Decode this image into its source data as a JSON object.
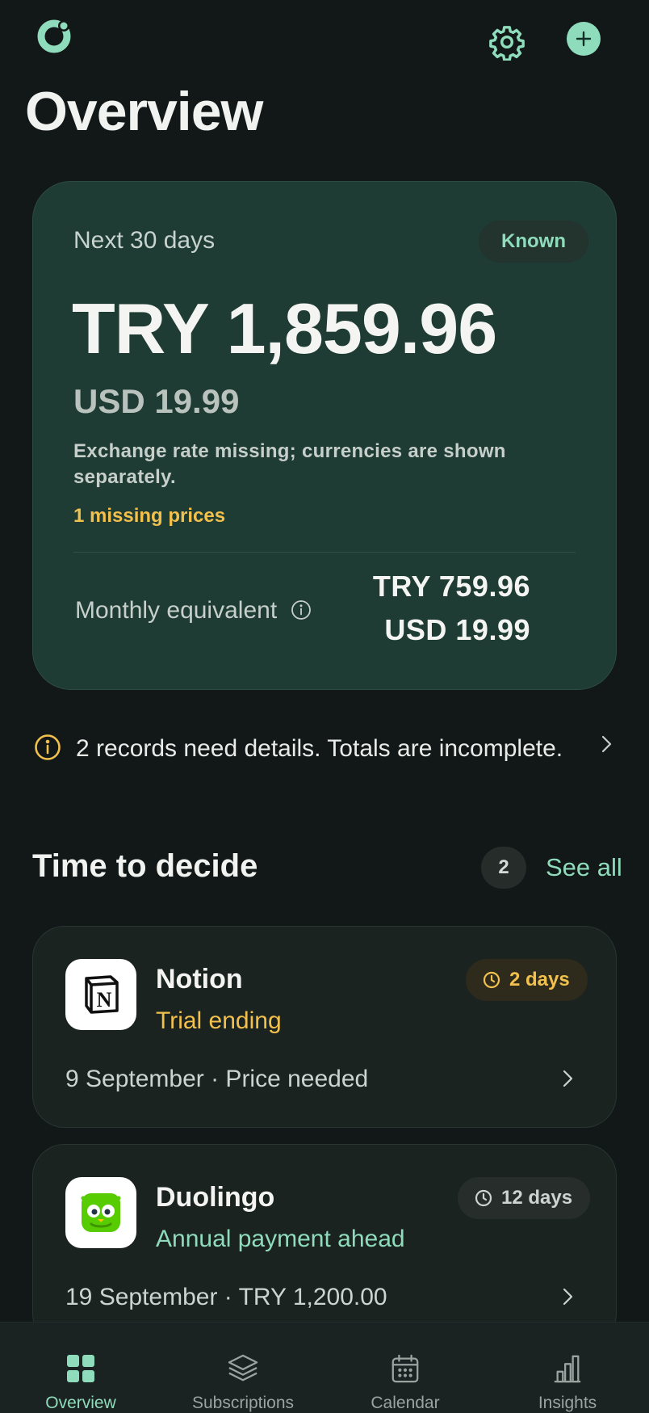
{
  "header": {
    "title": "Overview"
  },
  "summary": {
    "period_label": "Next 30 days",
    "badge": "Known",
    "total_primary": "TRY 1,859.96",
    "total_secondary": "USD 19.99",
    "exchange_note": "Exchange rate missing; currencies are shown separately.",
    "missing_note": "1 missing prices",
    "monthly_label": "Monthly equivalent",
    "monthly_try": "TRY 759.96",
    "monthly_usd": "USD 19.99"
  },
  "notice": {
    "text": "2 records need details. Totals are incomplete."
  },
  "decide": {
    "title": "Time to decide",
    "count": "2",
    "see_all": "See all",
    "items": [
      {
        "name": "Notion",
        "status": "Trial ending",
        "badge": "2 days",
        "detail": "9 September · Price needed",
        "status_color": "#f2c04d",
        "icon": "notion-logo"
      },
      {
        "name": "Duolingo",
        "status": "Annual payment ahead",
        "badge": "12 days",
        "detail": "19 September · TRY 1,200.00",
        "status_color": "#8fdcbc",
        "icon": "duolingo-logo"
      }
    ]
  },
  "nav": {
    "items": [
      {
        "label": "Overview",
        "icon": "grid-icon",
        "active": true
      },
      {
        "label": "Subscriptions",
        "icon": "layers-icon",
        "active": false
      },
      {
        "label": "Calendar",
        "icon": "calendar-icon",
        "active": false
      },
      {
        "label": "Insights",
        "icon": "bar-chart-icon",
        "active": false
      }
    ]
  },
  "colors": {
    "accent": "#8fdcbc",
    "warning": "#f2c04d",
    "background": "#121818",
    "card": "#1e3b34"
  }
}
